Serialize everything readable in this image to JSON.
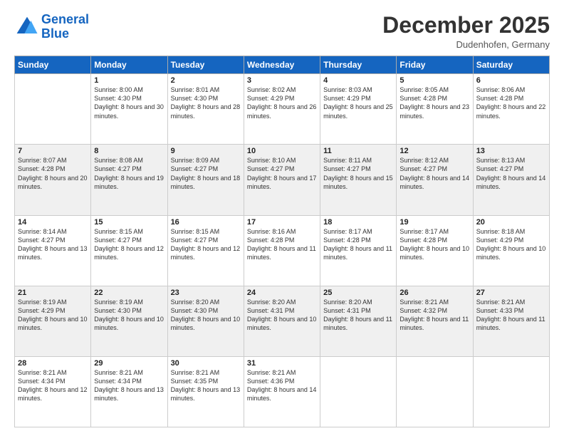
{
  "header": {
    "logo_line1": "General",
    "logo_line2": "Blue",
    "month": "December 2025",
    "location": "Dudenhofen, Germany"
  },
  "weekdays": [
    "Sunday",
    "Monday",
    "Tuesday",
    "Wednesday",
    "Thursday",
    "Friday",
    "Saturday"
  ],
  "weeks": [
    [
      {
        "day": "",
        "sunrise": "",
        "sunset": "",
        "daylight": ""
      },
      {
        "day": "1",
        "sunrise": "Sunrise: 8:00 AM",
        "sunset": "Sunset: 4:30 PM",
        "daylight": "Daylight: 8 hours and 30 minutes."
      },
      {
        "day": "2",
        "sunrise": "Sunrise: 8:01 AM",
        "sunset": "Sunset: 4:30 PM",
        "daylight": "Daylight: 8 hours and 28 minutes."
      },
      {
        "day": "3",
        "sunrise": "Sunrise: 8:02 AM",
        "sunset": "Sunset: 4:29 PM",
        "daylight": "Daylight: 8 hours and 26 minutes."
      },
      {
        "day": "4",
        "sunrise": "Sunrise: 8:03 AM",
        "sunset": "Sunset: 4:29 PM",
        "daylight": "Daylight: 8 hours and 25 minutes."
      },
      {
        "day": "5",
        "sunrise": "Sunrise: 8:05 AM",
        "sunset": "Sunset: 4:28 PM",
        "daylight": "Daylight: 8 hours and 23 minutes."
      },
      {
        "day": "6",
        "sunrise": "Sunrise: 8:06 AM",
        "sunset": "Sunset: 4:28 PM",
        "daylight": "Daylight: 8 hours and 22 minutes."
      }
    ],
    [
      {
        "day": "7",
        "sunrise": "Sunrise: 8:07 AM",
        "sunset": "Sunset: 4:28 PM",
        "daylight": "Daylight: 8 hours and 20 minutes."
      },
      {
        "day": "8",
        "sunrise": "Sunrise: 8:08 AM",
        "sunset": "Sunset: 4:27 PM",
        "daylight": "Daylight: 8 hours and 19 minutes."
      },
      {
        "day": "9",
        "sunrise": "Sunrise: 8:09 AM",
        "sunset": "Sunset: 4:27 PM",
        "daylight": "Daylight: 8 hours and 18 minutes."
      },
      {
        "day": "10",
        "sunrise": "Sunrise: 8:10 AM",
        "sunset": "Sunset: 4:27 PM",
        "daylight": "Daylight: 8 hours and 17 minutes."
      },
      {
        "day": "11",
        "sunrise": "Sunrise: 8:11 AM",
        "sunset": "Sunset: 4:27 PM",
        "daylight": "Daylight: 8 hours and 15 minutes."
      },
      {
        "day": "12",
        "sunrise": "Sunrise: 8:12 AM",
        "sunset": "Sunset: 4:27 PM",
        "daylight": "Daylight: 8 hours and 14 minutes."
      },
      {
        "day": "13",
        "sunrise": "Sunrise: 8:13 AM",
        "sunset": "Sunset: 4:27 PM",
        "daylight": "Daylight: 8 hours and 14 minutes."
      }
    ],
    [
      {
        "day": "14",
        "sunrise": "Sunrise: 8:14 AM",
        "sunset": "Sunset: 4:27 PM",
        "daylight": "Daylight: 8 hours and 13 minutes."
      },
      {
        "day": "15",
        "sunrise": "Sunrise: 8:15 AM",
        "sunset": "Sunset: 4:27 PM",
        "daylight": "Daylight: 8 hours and 12 minutes."
      },
      {
        "day": "16",
        "sunrise": "Sunrise: 8:15 AM",
        "sunset": "Sunset: 4:27 PM",
        "daylight": "Daylight: 8 hours and 12 minutes."
      },
      {
        "day": "17",
        "sunrise": "Sunrise: 8:16 AM",
        "sunset": "Sunset: 4:28 PM",
        "daylight": "Daylight: 8 hours and 11 minutes."
      },
      {
        "day": "18",
        "sunrise": "Sunrise: 8:17 AM",
        "sunset": "Sunset: 4:28 PM",
        "daylight": "Daylight: 8 hours and 11 minutes."
      },
      {
        "day": "19",
        "sunrise": "Sunrise: 8:17 AM",
        "sunset": "Sunset: 4:28 PM",
        "daylight": "Daylight: 8 hours and 10 minutes."
      },
      {
        "day": "20",
        "sunrise": "Sunrise: 8:18 AM",
        "sunset": "Sunset: 4:29 PM",
        "daylight": "Daylight: 8 hours and 10 minutes."
      }
    ],
    [
      {
        "day": "21",
        "sunrise": "Sunrise: 8:19 AM",
        "sunset": "Sunset: 4:29 PM",
        "daylight": "Daylight: 8 hours and 10 minutes."
      },
      {
        "day": "22",
        "sunrise": "Sunrise: 8:19 AM",
        "sunset": "Sunset: 4:30 PM",
        "daylight": "Daylight: 8 hours and 10 minutes."
      },
      {
        "day": "23",
        "sunrise": "Sunrise: 8:20 AM",
        "sunset": "Sunset: 4:30 PM",
        "daylight": "Daylight: 8 hours and 10 minutes."
      },
      {
        "day": "24",
        "sunrise": "Sunrise: 8:20 AM",
        "sunset": "Sunset: 4:31 PM",
        "daylight": "Daylight: 8 hours and 10 minutes."
      },
      {
        "day": "25",
        "sunrise": "Sunrise: 8:20 AM",
        "sunset": "Sunset: 4:31 PM",
        "daylight": "Daylight: 8 hours and 11 minutes."
      },
      {
        "day": "26",
        "sunrise": "Sunrise: 8:21 AM",
        "sunset": "Sunset: 4:32 PM",
        "daylight": "Daylight: 8 hours and 11 minutes."
      },
      {
        "day": "27",
        "sunrise": "Sunrise: 8:21 AM",
        "sunset": "Sunset: 4:33 PM",
        "daylight": "Daylight: 8 hours and 11 minutes."
      }
    ],
    [
      {
        "day": "28",
        "sunrise": "Sunrise: 8:21 AM",
        "sunset": "Sunset: 4:34 PM",
        "daylight": "Daylight: 8 hours and 12 minutes."
      },
      {
        "day": "29",
        "sunrise": "Sunrise: 8:21 AM",
        "sunset": "Sunset: 4:34 PM",
        "daylight": "Daylight: 8 hours and 13 minutes."
      },
      {
        "day": "30",
        "sunrise": "Sunrise: 8:21 AM",
        "sunset": "Sunset: 4:35 PM",
        "daylight": "Daylight: 8 hours and 13 minutes."
      },
      {
        "day": "31",
        "sunrise": "Sunrise: 8:21 AM",
        "sunset": "Sunset: 4:36 PM",
        "daylight": "Daylight: 8 hours and 14 minutes."
      },
      {
        "day": "",
        "sunrise": "",
        "sunset": "",
        "daylight": ""
      },
      {
        "day": "",
        "sunrise": "",
        "sunset": "",
        "daylight": ""
      },
      {
        "day": "",
        "sunrise": "",
        "sunset": "",
        "daylight": ""
      }
    ]
  ]
}
